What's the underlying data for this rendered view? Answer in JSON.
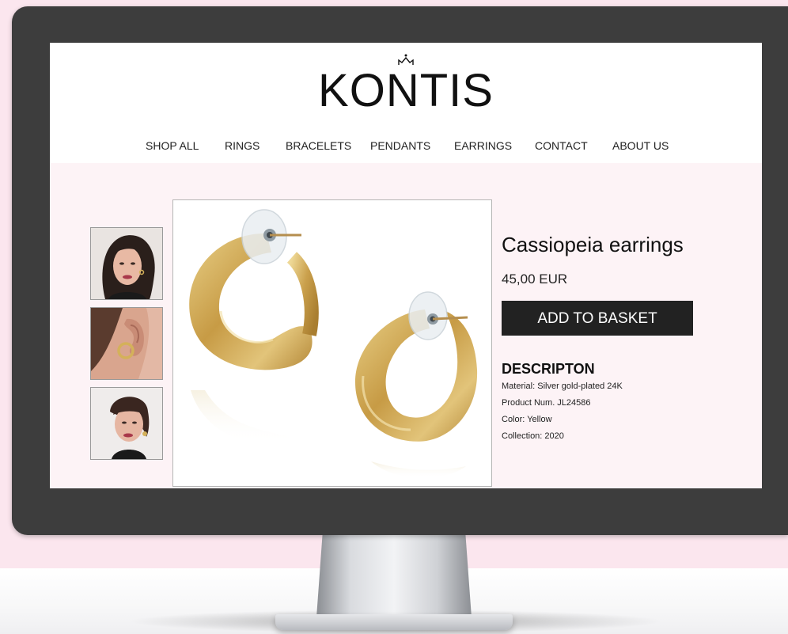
{
  "brand": {
    "logo_text": "KONTIS",
    "logo_icon": "crown-icon"
  },
  "nav": {
    "items": [
      {
        "label": "SHOP ALL"
      },
      {
        "label": "RINGS"
      },
      {
        "label": "BRACELETS"
      },
      {
        "label": "PENDANTS"
      },
      {
        "label": "EARRINGS"
      },
      {
        "label": "CONTACT"
      },
      {
        "label": "ABOUT US"
      }
    ]
  },
  "gallery": {
    "thumbnails": [
      {
        "name": "model-front-photo"
      },
      {
        "name": "ear-closeup-photo"
      },
      {
        "name": "model-side-photo"
      }
    ],
    "main_image": "gold-hoop-earrings-photo"
  },
  "product": {
    "title": "Cassiopeia earrings",
    "price": "45,00 EUR",
    "add_to_basket_label": "ADD TO BASKET",
    "description_heading": "DESCRIPTON",
    "description_lines": [
      "Material: Silver gold-plated 24K",
      "Product Num. JL24586",
      "Color: Yellow",
      "Collection: 2020"
    ]
  },
  "colors": {
    "background_pink": "#fbe6ee",
    "content_bg": "#fdf3f6",
    "bezel": "#3d3d3d",
    "button_bg": "#222222",
    "gold": "#d4b15a"
  }
}
